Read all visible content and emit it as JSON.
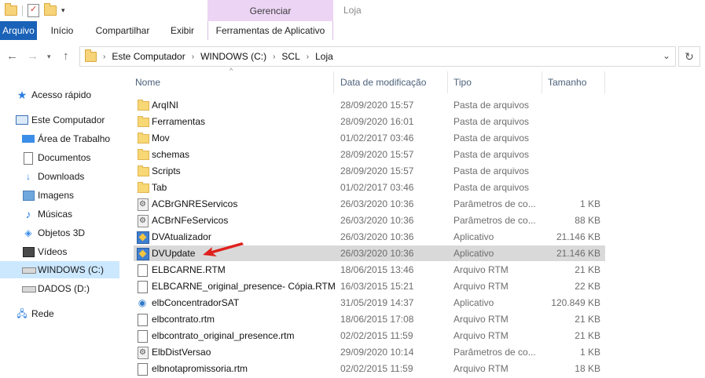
{
  "window": {
    "title": "Loja",
    "context_group": "Gerenciar"
  },
  "ribbon": {
    "tabs": [
      "Arquivo",
      "Início",
      "Compartilhar",
      "Exibir",
      "Ferramentas de Aplicativo"
    ]
  },
  "address": {
    "crumbs": [
      "Este Computador",
      "WINDOWS (C:)",
      "SCL",
      "Loja"
    ]
  },
  "nav": {
    "items": [
      {
        "label": "Acesso rápido",
        "icon": "star-icon"
      },
      {
        "label": "Este Computador",
        "icon": "computer-icon"
      },
      {
        "label": "Área de Trabalho",
        "icon": "desktop-icon"
      },
      {
        "label": "Documentos",
        "icon": "documents-icon"
      },
      {
        "label": "Downloads",
        "icon": "download-icon"
      },
      {
        "label": "Imagens",
        "icon": "pictures-icon"
      },
      {
        "label": "Músicas",
        "icon": "music-icon"
      },
      {
        "label": "Objetos 3D",
        "icon": "3d-objects-icon"
      },
      {
        "label": "Vídeos",
        "icon": "videos-icon"
      },
      {
        "label": "WINDOWS (C:)",
        "icon": "drive-icon"
      },
      {
        "label": "DADOS (D:)",
        "icon": "drive-icon"
      },
      {
        "label": "Rede",
        "icon": "network-icon"
      }
    ]
  },
  "columns": {
    "name": "Nome",
    "date": "Data de modificação",
    "type": "Tipo",
    "size": "Tamanho"
  },
  "files": [
    {
      "name": "ArqINI",
      "date": "28/09/2020 15:57",
      "type": "Pasta de arquivos",
      "size": "",
      "icon": "folder"
    },
    {
      "name": "Ferramentas",
      "date": "28/09/2020 16:01",
      "type": "Pasta de arquivos",
      "size": "",
      "icon": "folder"
    },
    {
      "name": "Mov",
      "date": "01/02/2017 03:46",
      "type": "Pasta de arquivos",
      "size": "",
      "icon": "folder"
    },
    {
      "name": "schemas",
      "date": "28/09/2020 15:57",
      "type": "Pasta de arquivos",
      "size": "",
      "icon": "folder"
    },
    {
      "name": "Scripts",
      "date": "28/09/2020 15:57",
      "type": "Pasta de arquivos",
      "size": "",
      "icon": "folder"
    },
    {
      "name": "Tab",
      "date": "01/02/2017 03:46",
      "type": "Pasta de arquivos",
      "size": "",
      "icon": "folder"
    },
    {
      "name": "ACBrGNREServicos",
      "date": "26/03/2020 10:36",
      "type": "Parâmetros de co...",
      "size": "1 KB",
      "icon": "config"
    },
    {
      "name": "ACBrNFeServicos",
      "date": "26/03/2020 10:36",
      "type": "Parâmetros de co...",
      "size": "88 KB",
      "icon": "config"
    },
    {
      "name": "DVAtualizador",
      "date": "26/03/2020 10:36",
      "type": "Aplicativo",
      "size": "21.146 KB",
      "icon": "app"
    },
    {
      "name": "DVUpdate",
      "date": "26/03/2020 10:36",
      "type": "Aplicativo",
      "size": "21.146 KB",
      "icon": "app",
      "selected": true
    },
    {
      "name": "ELBCARNE.RTM",
      "date": "18/06/2015 13:46",
      "type": "Arquivo RTM",
      "size": "21 KB",
      "icon": "rtm"
    },
    {
      "name": "ELBCARNE_original_presence- Cópia.RTM",
      "date": "16/03/2015 15:21",
      "type": "Arquivo RTM",
      "size": "22 KB",
      "icon": "rtm"
    },
    {
      "name": "elbConcentradorSAT",
      "date": "31/05/2019 14:37",
      "type": "Aplicativo",
      "size": "120.849 KB",
      "icon": "sat"
    },
    {
      "name": "elbcontrato.rtm",
      "date": "18/06/2015 17:08",
      "type": "Arquivo RTM",
      "size": "21 KB",
      "icon": "rtm"
    },
    {
      "name": "elbcontrato_original_presence.rtm",
      "date": "02/02/2015 11:59",
      "type": "Arquivo RTM",
      "size": "21 KB",
      "icon": "rtm"
    },
    {
      "name": "ElbDistVersao",
      "date": "29/09/2020 10:14",
      "type": "Parâmetros de co...",
      "size": "1 KB",
      "icon": "config"
    },
    {
      "name": "elbnotapromissoria.rtm",
      "date": "02/02/2015 11:59",
      "type": "Arquivo RTM",
      "size": "18 KB",
      "icon": "rtm"
    }
  ],
  "colors": {
    "accent": "#1a62b8",
    "context_tab": "#ecd4f4",
    "selection": "#d9d9d9",
    "annotation_arrow": "#e0201c"
  }
}
